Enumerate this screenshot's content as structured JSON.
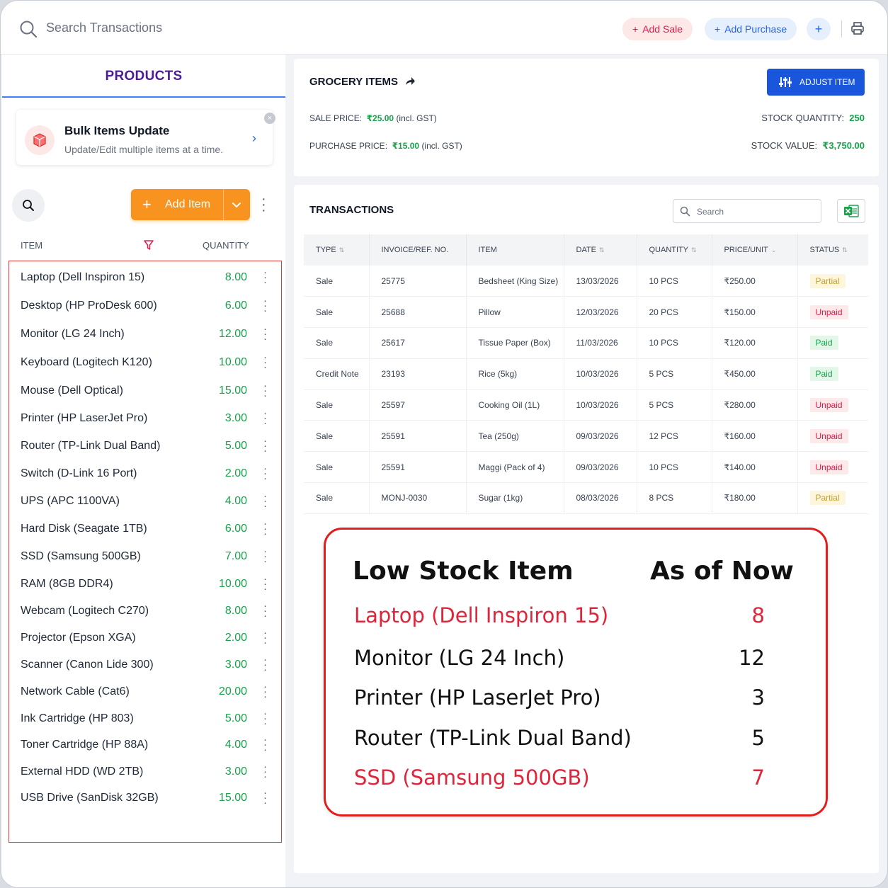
{
  "topbar": {
    "search_placeholder": "Search Transactions",
    "add_sale": "Add Sale",
    "add_purchase": "Add Purchase",
    "plus": "+"
  },
  "left": {
    "tab_title": "PRODUCTS",
    "bulk": {
      "title": "Bulk Items Update",
      "subtitle": "Update/Edit multiple items at a time."
    },
    "add_item": "Add Item",
    "col_item": "ITEM",
    "col_quantity": "QUANTITY",
    "items": [
      {
        "name": "Laptop (Dell Inspiron 15)",
        "qty": "8.00"
      },
      {
        "name": "Desktop (HP ProDesk 600)",
        "qty": "6.00"
      },
      {
        "name": "Monitor (LG 24 Inch)",
        "qty": "12.00"
      },
      {
        "name": "Keyboard (Logitech K120)",
        "qty": "10.00"
      },
      {
        "name": "Mouse (Dell Optical)",
        "qty": "15.00"
      },
      {
        "name": "Printer (HP LaserJet Pro)",
        "qty": "3.00"
      },
      {
        "name": "Router (TP-Link Dual Band)",
        "qty": "5.00"
      },
      {
        "name": "Switch (D-Link 16 Port)",
        "qty": "2.00"
      },
      {
        "name": "UPS (APC 1100VA)",
        "qty": "4.00"
      },
      {
        "name": "Hard Disk (Seagate 1TB)",
        "qty": "6.00"
      },
      {
        "name": "SSD (Samsung 500GB)",
        "qty": "7.00"
      },
      {
        "name": "RAM (8GB DDR4)",
        "qty": "10.00"
      },
      {
        "name": "Webcam (Logitech C270)",
        "qty": "8.00"
      },
      {
        "name": "Projector (Epson XGA)",
        "qty": "2.00"
      },
      {
        "name": "Scanner (Canon Lide 300)",
        "qty": "3.00"
      },
      {
        "name": "Network Cable (Cat6)",
        "qty": "20.00"
      },
      {
        "name": "Ink Cartridge (HP 803)",
        "qty": "5.00"
      },
      {
        "name": "Toner Cartridge (HP 88A)",
        "qty": "4.00"
      },
      {
        "name": "External HDD (WD 2TB)",
        "qty": "3.00"
      },
      {
        "name": "USB Drive (SanDisk 32GB)",
        "qty": "15.00"
      }
    ]
  },
  "detail": {
    "title": "GROCERY ITEMS",
    "adjust": "ADJUST ITEM",
    "sale_price_label": "SALE PRICE:",
    "sale_price": "₹25.00",
    "sale_price_note": "(incl. GST)",
    "purchase_price_label": "PURCHASE PRICE:",
    "purchase_price": "₹15.00",
    "purchase_price_note": "(incl. GST)",
    "stock_qty_label": "STOCK QUANTITY:",
    "stock_qty": "250",
    "stock_value_label": "STOCK VALUE:",
    "stock_value": "₹3,750.00"
  },
  "transactions": {
    "title": "TRANSACTIONS",
    "search_placeholder": "Search",
    "headers": [
      "TYPE",
      "INVOICE/REF. NO.",
      "ITEM",
      "DATE",
      "QUANTITY",
      "PRICE/UNIT",
      "STATUS"
    ],
    "rows": [
      {
        "type": "Sale",
        "invoice": "25775",
        "item": "Bedsheet (King Size)",
        "date": "13/03/2026",
        "qty": "10 PCS",
        "price": "₹250.00",
        "status": "Partial"
      },
      {
        "type": "Sale",
        "invoice": "25688",
        "item": "Pillow",
        "date": "12/03/2026",
        "qty": "20 PCS",
        "price": "₹150.00",
        "status": "Unpaid"
      },
      {
        "type": "Sale",
        "invoice": "25617",
        "item": "Tissue Paper (Box)",
        "date": "11/03/2026",
        "qty": "10 PCS",
        "price": "₹120.00",
        "status": "Paid"
      },
      {
        "type": "Credit Note",
        "invoice": "23193",
        "item": "Rice (5kg)",
        "date": "10/03/2026",
        "qty": "5 PCS",
        "price": "₹450.00",
        "status": "Paid"
      },
      {
        "type": "Sale",
        "invoice": "25597",
        "item": "Cooking Oil (1L)",
        "date": "10/03/2026",
        "qty": "5 PCS",
        "price": "₹280.00",
        "status": "Unpaid"
      },
      {
        "type": "Sale",
        "invoice": "25591",
        "item": "Tea (250g)",
        "date": "09/03/2026",
        "qty": "12 PCS",
        "price": "₹160.00",
        "status": "Unpaid"
      },
      {
        "type": "Sale",
        "invoice": "25591",
        "item": "Maggi (Pack of 4)",
        "date": "09/03/2026",
        "qty": "10 PCS",
        "price": "₹140.00",
        "status": "Unpaid"
      },
      {
        "type": "Sale",
        "invoice": "MONJ-0030",
        "item": "Sugar (1kg)",
        "date": "08/03/2026",
        "qty": "8 PCS",
        "price": "₹180.00",
        "status": "Partial"
      }
    ]
  },
  "low_stock": {
    "heading_item": "Low Stock Item",
    "heading_now": "As of Now",
    "rows": [
      {
        "name": "Laptop (Dell Inspiron 15)",
        "value": "8",
        "highlight": true
      },
      {
        "name": "Monitor (LG 24 Inch)",
        "value": "12",
        "highlight": false
      },
      {
        "name": "Printer (HP LaserJet Pro)",
        "value": "3",
        "highlight": false
      },
      {
        "name": "Router (TP-Link Dual Band)",
        "value": "5",
        "highlight": false
      },
      {
        "name": "SSD (Samsung 500GB)",
        "value": "7",
        "highlight": true
      }
    ]
  },
  "colors": {
    "accent_blue": "#1a56db",
    "accent_orange": "#f7931e",
    "qty_green": "#16a34a",
    "alert_red": "#e01e1e"
  }
}
